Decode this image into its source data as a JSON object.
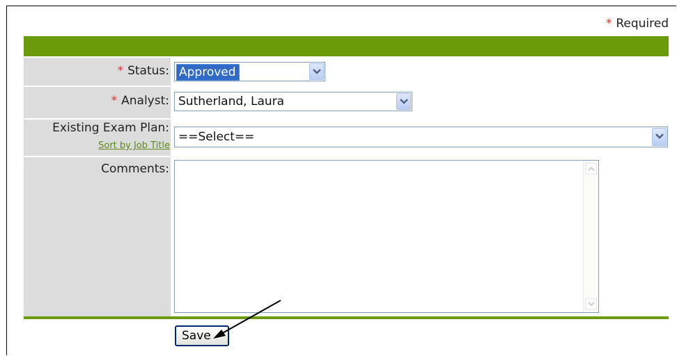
{
  "required_note": {
    "asterisk": "*",
    "label": "Required"
  },
  "form": {
    "status": {
      "asterisk": "*",
      "label": "Status:",
      "value": "Approved"
    },
    "analyst": {
      "asterisk": "*",
      "label": "Analyst:",
      "value": "Sutherland, Laura"
    },
    "exam_plan": {
      "label": "Existing Exam Plan:",
      "sort_link": "Sort by Job Title",
      "value": "==Select=="
    },
    "comments": {
      "label": "Comments:",
      "value": ""
    }
  },
  "actions": {
    "save_label": "Save"
  },
  "colors": {
    "accent_green": "#6b9b0a",
    "required_red": "#e0302e",
    "label_bg": "#dcdcdc",
    "selection_blue": "#316ac5"
  }
}
